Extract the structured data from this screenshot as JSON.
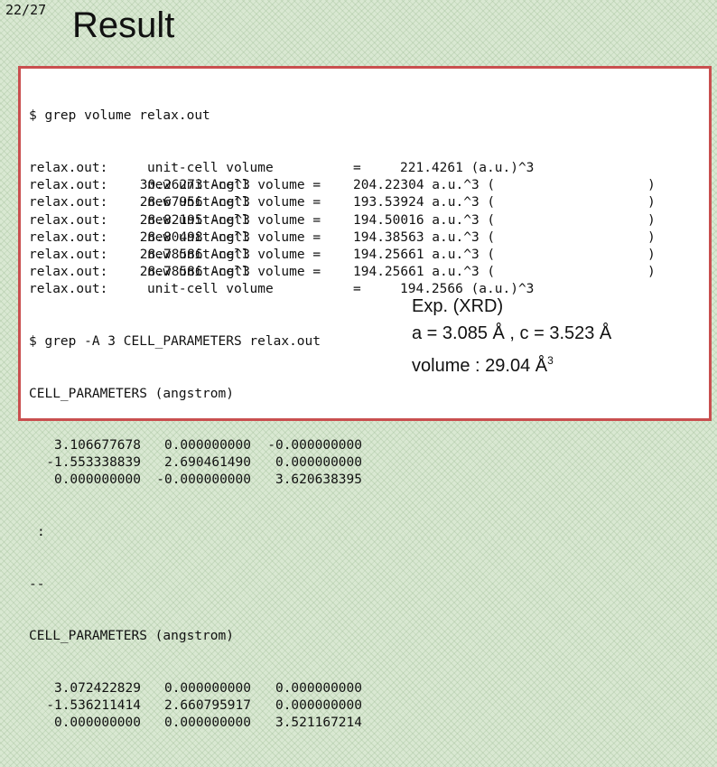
{
  "slide": {
    "page_number": "22/27",
    "title": "Result"
  },
  "terminal": {
    "cmd1": "$ grep volume relax.out",
    "volume_rows": [
      {
        "prefix": "relax.out:",
        "label": "unit-cell volume",
        "eq": "=",
        "value": "221.4261 (a.u.)^3",
        "ang": "",
        "paren": ""
      },
      {
        "prefix": "relax.out:",
        "label": "new unit-cell volume =",
        "eq": "",
        "value": "204.22304 a.u.^3 (",
        "ang": "30.26273 Ang^3",
        "paren": ")"
      },
      {
        "prefix": "relax.out:",
        "label": "new unit-cell volume =",
        "eq": "",
        "value": "193.53924 a.u.^3 (",
        "ang": "28.67956 Ang^3",
        "paren": ")"
      },
      {
        "prefix": "relax.out:",
        "label": "new unit-cell volume =",
        "eq": "",
        "value": "194.50016 a.u.^3 (",
        "ang": "28.82195 Ang^3",
        "paren": ")"
      },
      {
        "prefix": "relax.out:",
        "label": "new unit-cell volume =",
        "eq": "",
        "value": "194.38563 a.u.^3 (",
        "ang": "28.80498 Ang^3",
        "paren": ")"
      },
      {
        "prefix": "relax.out:",
        "label": "new unit-cell volume =",
        "eq": "",
        "value": "194.25661 a.u.^3 (",
        "ang": "28.78586 Ang^3",
        "paren": ")"
      },
      {
        "prefix": "relax.out:",
        "label": "new unit-cell volume =",
        "eq": "",
        "value": "194.25661 a.u.^3 (",
        "ang": "28.78586 Ang^3",
        "paren": ")"
      },
      {
        "prefix": "relax.out:",
        "label": "unit-cell volume",
        "eq": "=",
        "value": "194.2566 (a.u.)^3",
        "ang": "",
        "paren": ""
      }
    ],
    "cmd2": "$ grep -A 3 CELL_PARAMETERS relax.out",
    "cell_header_1": "CELL_PARAMETERS (angstrom)",
    "cell1": [
      [
        "3.106677678",
        "0.000000000",
        "-0.000000000"
      ],
      [
        "-1.553338839",
        "2.690461490",
        "0.000000000"
      ],
      [
        "0.000000000",
        "-0.000000000",
        "3.620638395"
      ]
    ],
    "ellipsis": ":",
    "separator": "--",
    "cell_header_2": "CELL_PARAMETERS (angstrom)",
    "cell2": [
      [
        "3.072422829",
        "0.000000000",
        "0.000000000"
      ],
      [
        "-1.536211414",
        "2.660795917",
        "0.000000000"
      ],
      [
        "0.000000000",
        "0.000000000",
        "3.521167214"
      ]
    ]
  },
  "xrd": {
    "title": "Exp. (XRD)",
    "lattice": "a = 3.085 Å , c = 3.523 Å",
    "volume_text": "volume : 29.04 Å",
    "volume_exp": "3"
  }
}
